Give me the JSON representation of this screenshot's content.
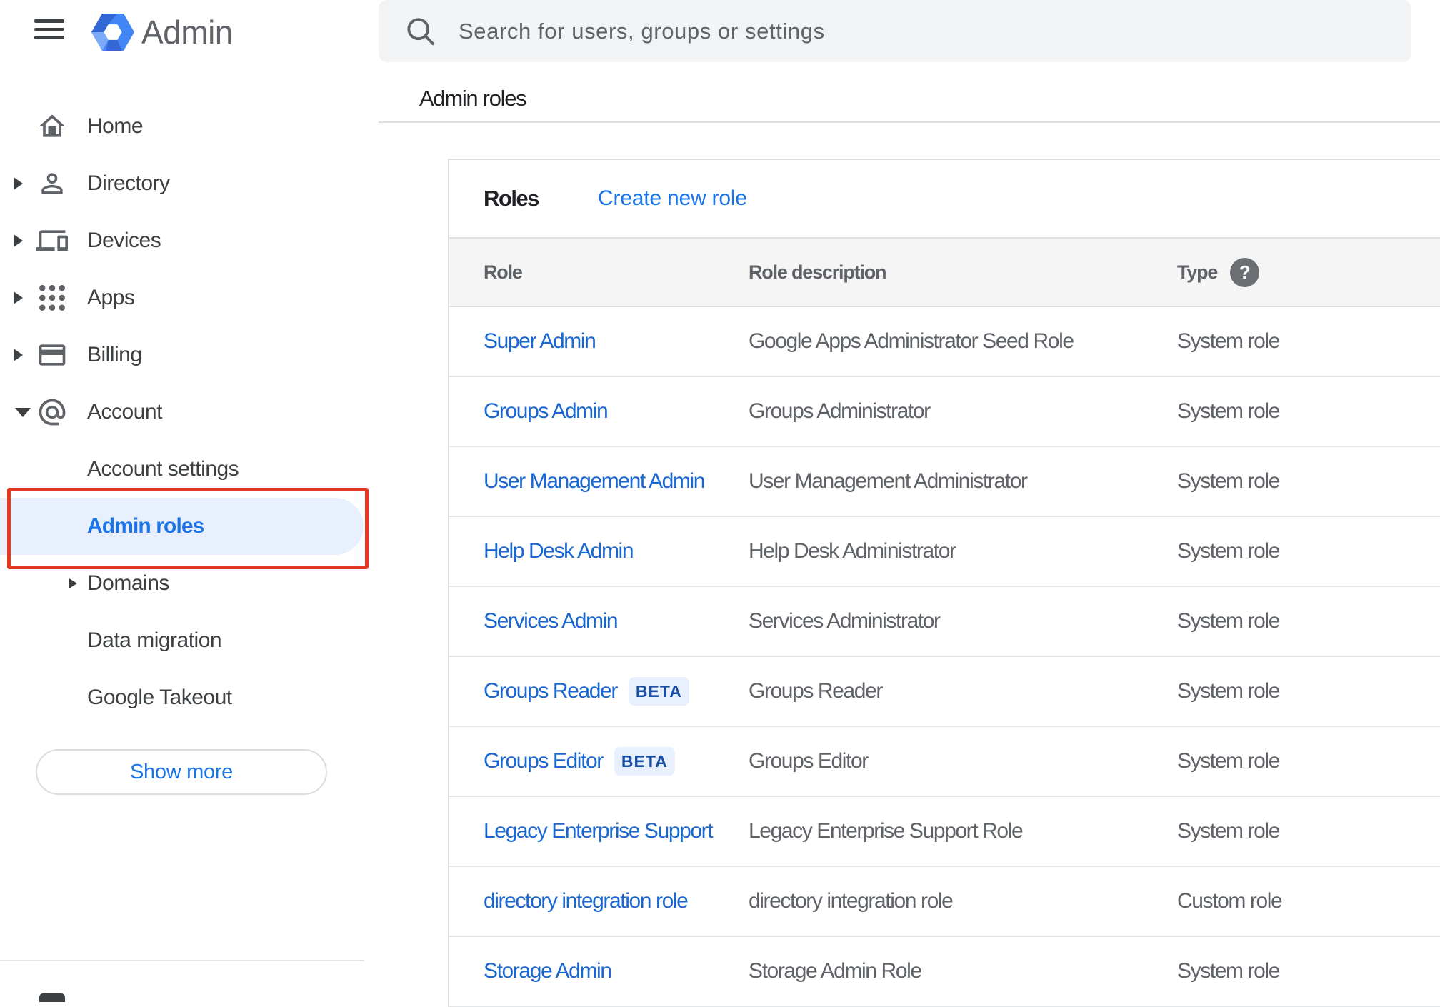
{
  "header": {
    "product_name": "Admin",
    "search_placeholder": "Search for users, groups or settings"
  },
  "page": {
    "title": "Admin roles"
  },
  "sidebar": {
    "items": [
      {
        "label": "Home",
        "icon": "home",
        "expandable": false
      },
      {
        "label": "Directory",
        "icon": "person",
        "expandable": true
      },
      {
        "label": "Devices",
        "icon": "devices",
        "expandable": true
      },
      {
        "label": "Apps",
        "icon": "apps-grid",
        "expandable": true
      },
      {
        "label": "Billing",
        "icon": "credit-card",
        "expandable": true
      },
      {
        "label": "Account",
        "icon": "at-sign",
        "expandable": true,
        "expanded": true
      }
    ],
    "account_subitems": [
      {
        "label": "Account settings"
      },
      {
        "label": "Admin roles",
        "selected": true,
        "annotated": true
      },
      {
        "label": "Domains",
        "expandable": true
      },
      {
        "label": "Data migration"
      },
      {
        "label": "Google Takeout"
      }
    ],
    "show_more_label": "Show more"
  },
  "roles_card": {
    "title": "Roles",
    "create_link": "Create new role",
    "columns": [
      "Role",
      "Role description",
      "Type"
    ],
    "help_glyph": "?",
    "beta_label": "BETA",
    "rows": [
      {
        "role": "Super Admin",
        "beta": false,
        "description": "Google Apps Administrator Seed Role",
        "type": "System role"
      },
      {
        "role": "Groups Admin",
        "beta": false,
        "description": "Groups Administrator",
        "type": "System role"
      },
      {
        "role": "User Management Admin",
        "beta": false,
        "description": "User Management Administrator",
        "type": "System role"
      },
      {
        "role": "Help Desk Admin",
        "beta": false,
        "description": "Help Desk Administrator",
        "type": "System role"
      },
      {
        "role": "Services Admin",
        "beta": false,
        "description": "Services Administrator",
        "type": "System role"
      },
      {
        "role": "Groups Reader",
        "beta": true,
        "description": "Groups Reader",
        "type": "System role"
      },
      {
        "role": "Groups Editor",
        "beta": true,
        "description": "Groups Editor",
        "type": "System role"
      },
      {
        "role": "Legacy Enterprise Support",
        "beta": false,
        "description": "Legacy Enterprise Support Role",
        "type": "System role"
      },
      {
        "role": "directory integration role",
        "beta": false,
        "description": "directory integration role",
        "type": "Custom role"
      },
      {
        "role": "Storage Admin",
        "beta": false,
        "description": "Storage Admin Role",
        "type": "System role"
      }
    ]
  },
  "colors": {
    "annotation_red": "#e63a1f",
    "selected_item_bg": "#e8f0fe",
    "sidebar_link_blue": "#1a73e8",
    "table_link_blue": "#1967d2",
    "beta_text_blue": "#174ea6",
    "searchbar_bg": "#f1f3f4",
    "table_header_bg": "#f5f5f6",
    "logo_blue": "#4285f4"
  }
}
